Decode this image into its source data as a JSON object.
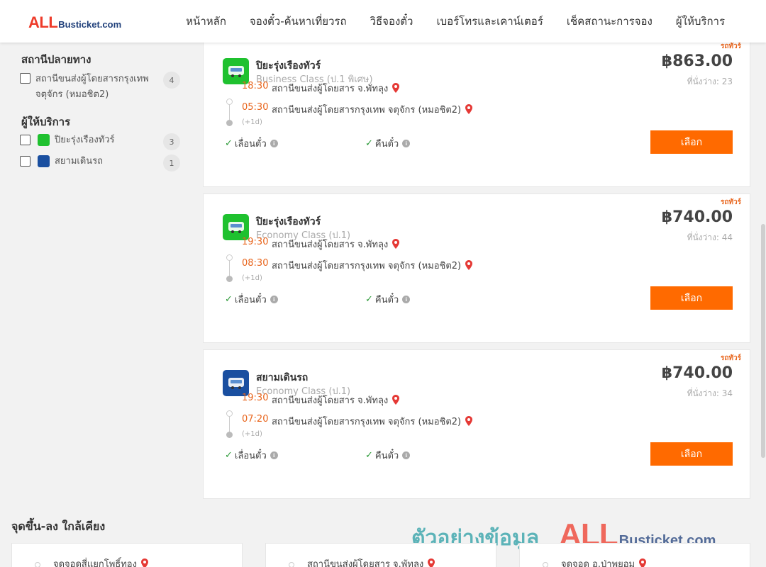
{
  "header": {
    "logo_all": "ALL",
    "logo_rest": "Busticket.com",
    "nav": [
      "หน้าหลัก",
      "จองตั๋ว-ค้นหาเที่ยวรถ",
      "วิธีจองตั๋ว",
      "เบอร์โทรและเคาน์เตอร์",
      "เช็คสถานะการจอง",
      "ผู้ให้บริการ"
    ]
  },
  "sidebar": {
    "destination_title": "สถานีปลายทาง",
    "destination_label_line1": "สถานีขนส่งผู้โดยสารกรุงเทพ",
    "destination_label_line2": "จตุจักร (หมอชิต2)",
    "destination_count": "4",
    "operator_title": "ผู้ให้บริการ",
    "operators": [
      {
        "name": "ปิยะรุ่งเรืองทัวร์",
        "count": "3",
        "color": "#1fc12f"
      },
      {
        "name": "สยามเดินรถ",
        "count": "1",
        "color": "#1a4fa0"
      }
    ]
  },
  "colors": {
    "accent": "#ff6a00",
    "time": "#e8641b",
    "pin": "#e53935",
    "check": "#2e9b3a"
  },
  "trips": [
    {
      "tag": "รถทัวร์",
      "operator": "ปิยะรุ่งเรืองทัวร์",
      "bus_class": "Business Class (ป.1 พิเศษ)",
      "price": "฿863.00",
      "seats": "ที่นั่งว่าง: 23",
      "dep_time": "18:30",
      "dep_place": "สถานีขนส่งผู้โดยสาร จ.พัทลุง",
      "arr_time": "05:30",
      "arr_place": "สถานีขนส่งผู้โดยสารกรุงเทพ จตุจักร (หมอชิต2)",
      "plus_day": "(+1d)",
      "feat1": "เลื่อนตั๋ว",
      "feat2": "คืนตั๋ว",
      "button": "เลือก",
      "logo_color": "#1fc12f"
    },
    {
      "tag": "รถทัวร์",
      "operator": "ปิยะรุ่งเรืองทัวร์",
      "bus_class": "Economy Class (ป.1)",
      "price": "฿740.00",
      "seats": "ที่นั่งว่าง: 44",
      "dep_time": "19:30",
      "dep_place": "สถานีขนส่งผู้โดยสาร จ.พัทลุง",
      "arr_time": "08:30",
      "arr_place": "สถานีขนส่งผู้โดยสารกรุงเทพ จตุจักร (หมอชิต2)",
      "plus_day": "(+1d)",
      "feat1": "เลื่อนตั๋ว",
      "feat2": "คืนตั๋ว",
      "button": "เลือก",
      "logo_color": "#1fc12f"
    },
    {
      "tag": "รถทัวร์",
      "operator": "สยามเดินรถ",
      "bus_class": "Economy Class (ป.1)",
      "price": "฿740.00",
      "seats": "ที่นั่งว่าง: 34",
      "dep_time": "19:30",
      "dep_place": "สถานีขนส่งผู้โดยสาร จ.พัทลุง",
      "arr_time": "07:20",
      "arr_place": "สถานีขนส่งผู้โดยสารกรุงเทพ จตุจักร (หมอชิต2)",
      "plus_day": "(+1d)",
      "feat1": "เลื่อนตั๋ว",
      "feat2": "คืนตั๋ว",
      "button": "เลือก",
      "logo_color": "#1a4fa0"
    }
  ],
  "nearby": {
    "title": "จุดขึ้น-ลง ใกล้เคียง",
    "items": [
      "จุดจอดสี่แยกโพธิ์ทอง",
      "สถานีขนส่งผู้โดยสาร จ.พัทลุง",
      "จุดจอด อ.ป่าพยอม"
    ]
  },
  "watermark": {
    "thai": "ตัวอย่างข้อมูล",
    "all": "ALL",
    "rest": "Busticket.com"
  }
}
